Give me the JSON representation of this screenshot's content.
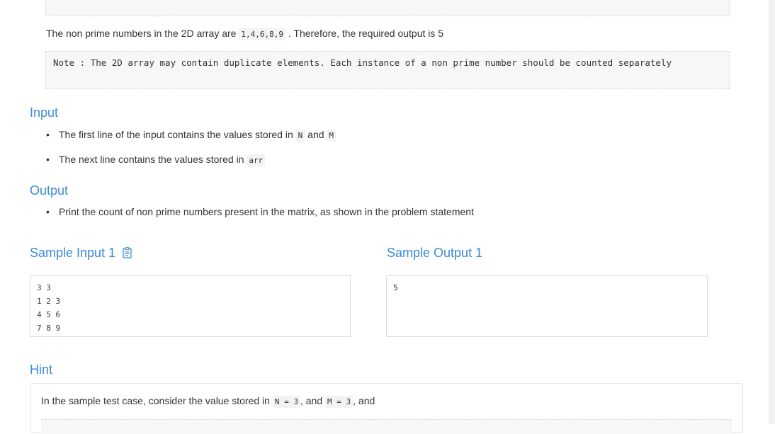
{
  "statement": {
    "nonprime_prefix": "The non prime numbers in the 2D array are",
    "nonprime_list": "1,4,6,8,9",
    "nonprime_suffix": ". Therefore, the required output is 5",
    "note": "Note : The 2D array may contain duplicate elements. Each instance of a non prime number should be counted separately"
  },
  "input_section": {
    "title": "Input",
    "items": [
      {
        "text": "The first line of the input contains the values stored in",
        "code1": "N",
        "mid": "and",
        "code2": "M"
      },
      {
        "text": "The next line contains the values stored in",
        "code1": "arr"
      }
    ]
  },
  "output_section": {
    "title": "Output",
    "items": [
      {
        "text": "Print the count of non prime numbers present in the matrix, as shown in the problem statement"
      }
    ]
  },
  "sample_input": {
    "title": "Sample Input 1",
    "content": "3 3\n1 2 3\n4 5 6\n7 8 9"
  },
  "sample_output": {
    "title": "Sample Output 1",
    "content": "5"
  },
  "hint": {
    "title": "Hint",
    "text_prefix": "In the sample test case, consider the value stored in",
    "code1": "N = 3",
    "mid": ", and",
    "code2": "M = 3",
    "suffix": ", and"
  },
  "icons": {
    "copy": "clipboard-icon"
  },
  "colors": {
    "heading": "#3b8ad9",
    "text": "#333333",
    "code_bg": "#f3f3f3"
  }
}
